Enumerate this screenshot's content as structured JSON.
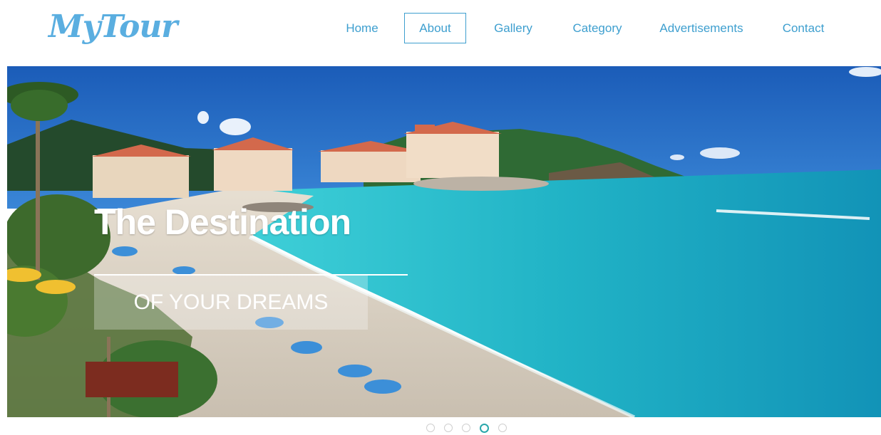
{
  "brand": {
    "logo_text": "MyTour",
    "accent_color": "#5aaee0",
    "nav_color": "#3e9fcf"
  },
  "nav": {
    "items": [
      {
        "label": "Home",
        "active": false
      },
      {
        "label": "About",
        "active": true
      },
      {
        "label": "Gallery",
        "active": false
      },
      {
        "label": "Category",
        "active": false
      },
      {
        "label": "Advertisements",
        "active": false
      },
      {
        "label": "Contact",
        "active": false
      }
    ]
  },
  "hero": {
    "title": "The Destination",
    "subtitle": "OF YOUR DREAMS",
    "image": "beach-resort-photo"
  },
  "slider": {
    "slide_count": 5,
    "active_index": 3,
    "active_color": "#2aa7ab"
  }
}
